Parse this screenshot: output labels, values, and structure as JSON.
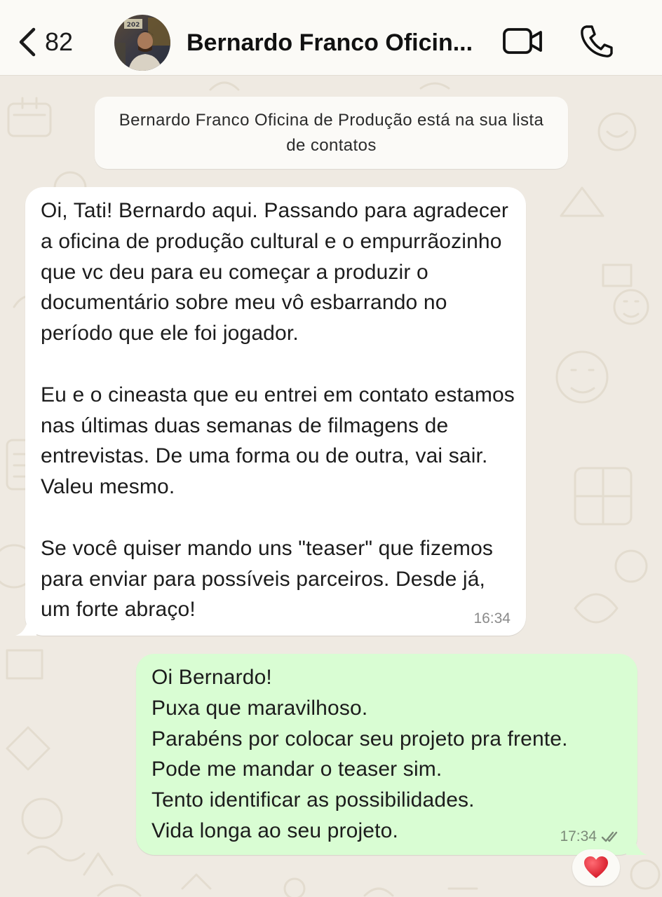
{
  "header": {
    "back_count": "82",
    "contact_name": "Bernardo Franco Oficin...",
    "avatar_sign": "202",
    "video_icon": "video-camera-icon",
    "call_icon": "phone-icon"
  },
  "system_note": {
    "text": "Bernardo Franco Oficina de Produção está na sua lista de contatos"
  },
  "messages": [
    {
      "direction": "incoming",
      "text": "Oi, Tati! Bernardo aqui. Passando para agradecer a oficina de produção cultural e o empurrãozinho que vc deu para eu começar a produzir o documentário sobre meu vô esbarrando no período que ele foi jogador.\n\nEu e o cineasta que eu entrei em contato estamos nas últimas duas semanas de filmagens de entrevistas. De uma forma ou de outra, vai sair. Valeu mesmo.\n\nSe você quiser mando uns \"teaser\" que fizemos para enviar para possíveis parceiros. Desde já, um forte abraço!",
      "time": "16:34"
    },
    {
      "direction": "outgoing",
      "text": "Oi Bernardo!\nPuxa que maravilhoso.\nParabéns por colocar seu projeto pra frente.\nPode me mandar o teaser sim.\nTento identificar as possibilidades.\nVida longa ao seu projeto.",
      "time": "17:34",
      "status_icon": "double-check-icon",
      "reaction": "❤️"
    }
  ],
  "colors": {
    "wallpaper": "#efeae2",
    "incoming_bubble": "#ffffff",
    "outgoing_bubble": "#d9fdd3",
    "reaction_heart": "#e0202e"
  }
}
